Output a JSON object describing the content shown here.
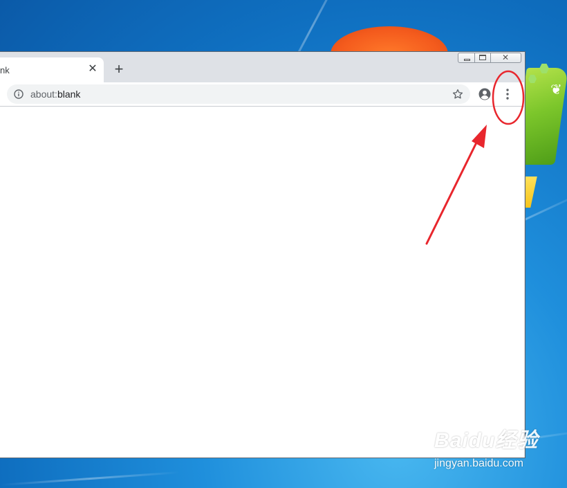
{
  "browser": {
    "tab": {
      "title": "nk",
      "close_symbol": "✕"
    },
    "new_tab_symbol": "+",
    "window_controls": {
      "close_symbol": "✕"
    },
    "omnibox": {
      "url_scheme": "about:",
      "url_path": "blank"
    }
  },
  "watermark": {
    "brand": "Baidu经验",
    "url": "jingyan.baidu.com"
  },
  "colors": {
    "annotation_red": "#e8262d",
    "chrome_frame": "#dee1e6",
    "omnibox_bg": "#f1f3f4",
    "icon_gray": "#5f6368"
  },
  "icons": [
    "info-icon",
    "star-icon",
    "profile-icon",
    "menu-icon",
    "close-icon",
    "plus-icon"
  ]
}
